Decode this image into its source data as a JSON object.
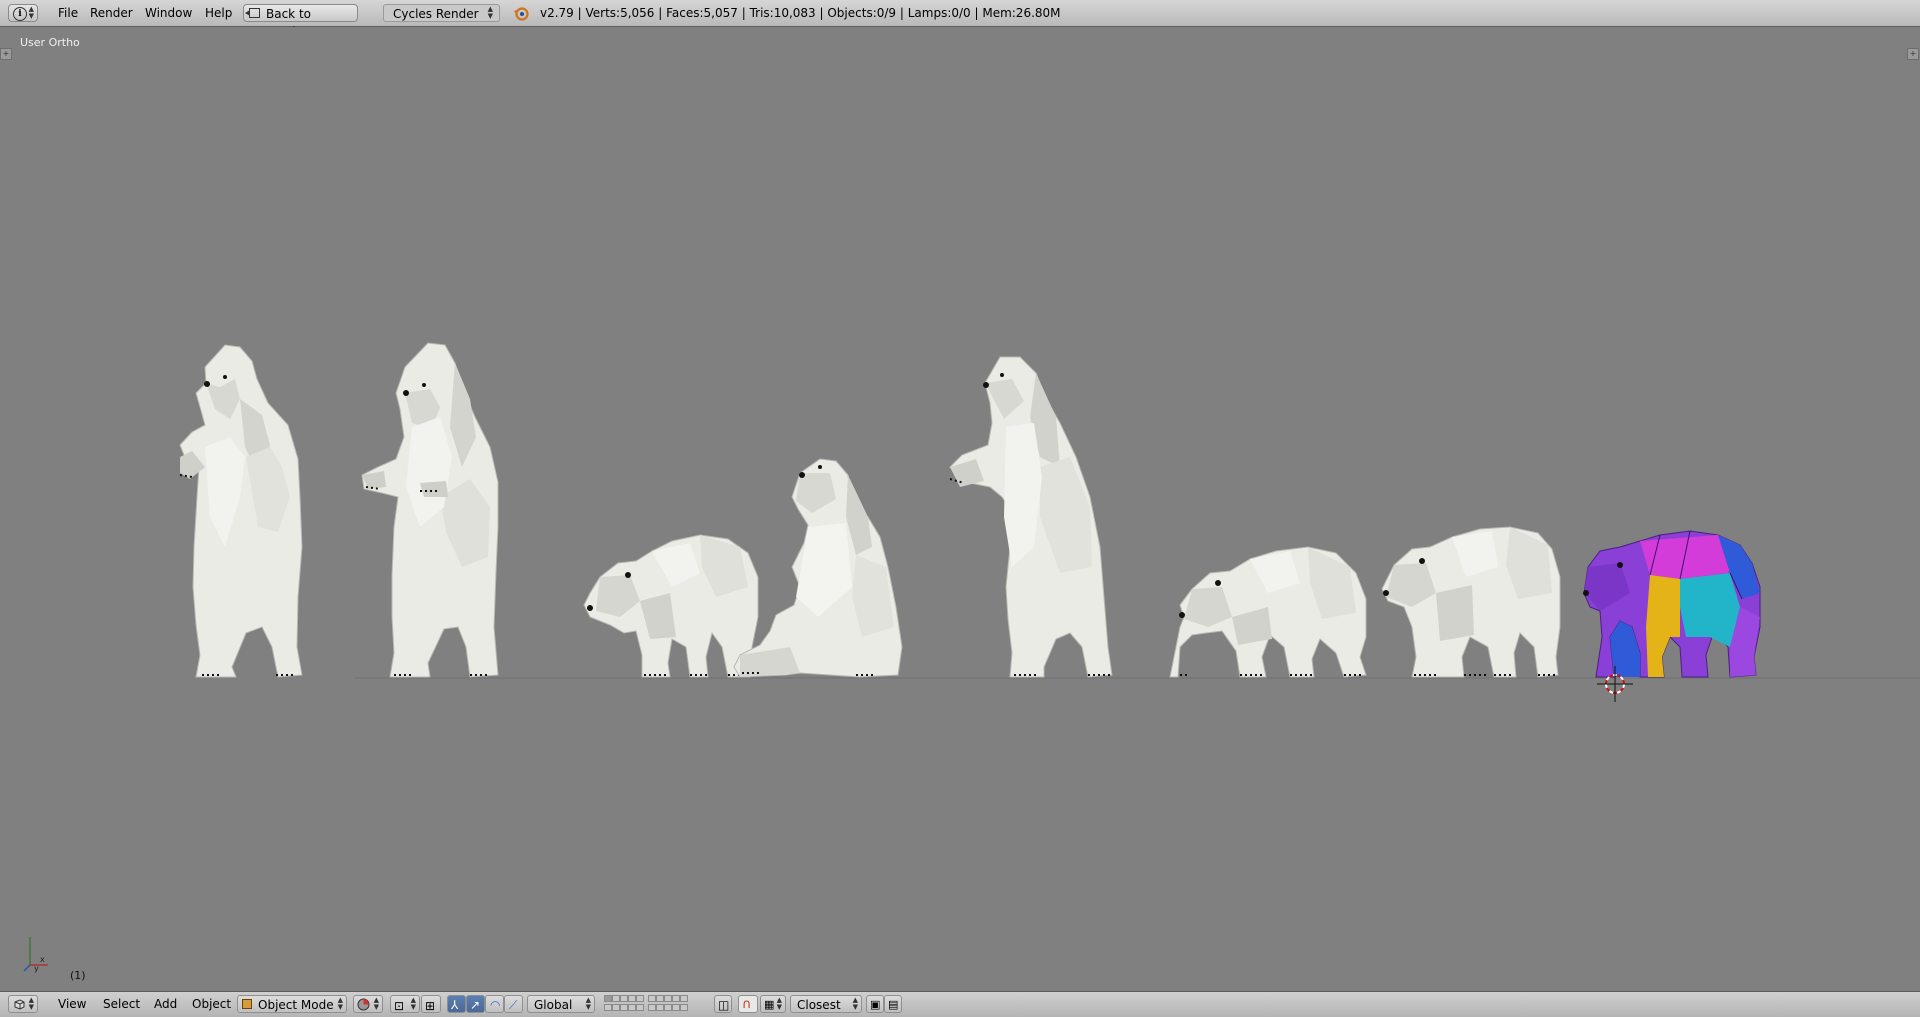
{
  "top_header": {
    "menus": [
      "File",
      "Render",
      "Window",
      "Help"
    ],
    "back_button": "Back to Previous",
    "render_engine": "Cycles Render",
    "stats": "v2.79 | Verts:5,056 | Faces:5,057 | Tris:10,083 | Objects:0/9 | Lamps:0/0 | Mem:26.80M"
  },
  "viewport": {
    "view_label": "User Ortho",
    "frame_label": "(1)",
    "axis_labels": {
      "x": "x",
      "y": "y"
    },
    "objects": [
      "polar-bear-standing-1",
      "polar-bear-standing-2",
      "polar-bear-walking-1",
      "polar-bear-sitting",
      "polar-bear-standing-3",
      "polar-bear-walking-2",
      "polar-bear-walking-3",
      "polar-bear-uv-textured"
    ],
    "colors": {
      "background": "#808080",
      "bear": "#ebebe6",
      "uv_purple": "#8a3fd6",
      "uv_magenta": "#d33cd8",
      "uv_blue": "#2f5bd8",
      "uv_yellow": "#e3b317",
      "uv_cyan": "#22b4c8"
    }
  },
  "bottom_header": {
    "menus": [
      "View",
      "Select",
      "Add",
      "Object"
    ],
    "mode": "Object Mode",
    "orientation": "Global",
    "snap_target": "Closest"
  }
}
